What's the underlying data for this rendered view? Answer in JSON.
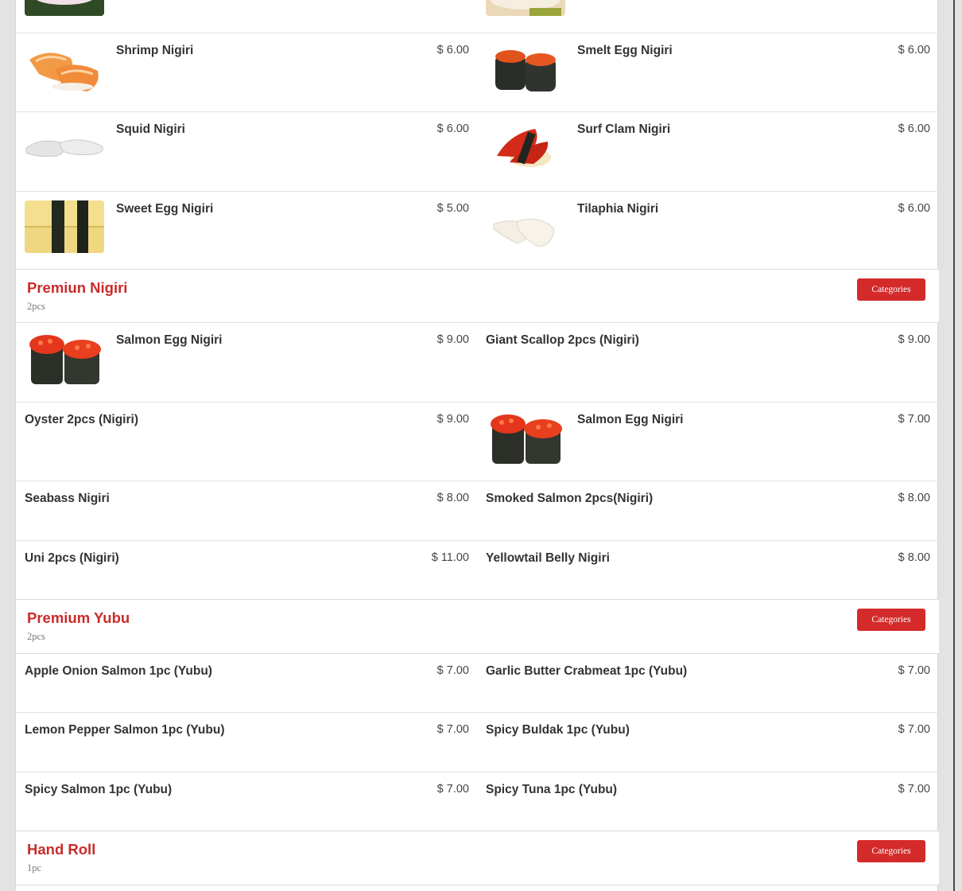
{
  "rows_nigiri": [
    {
      "left": {
        "name": "",
        "price": ""
      },
      "right": {
        "name": "",
        "price": ""
      }
    },
    {
      "left": {
        "name": "Shrimp Nigiri",
        "price": "$ 6.00",
        "image": "shrimp-nigiri-photo"
      },
      "right": {
        "name": "Smelt Egg Nigiri",
        "price": "$ 6.00",
        "image": "smelt-egg-nigiri-photo"
      }
    },
    {
      "left": {
        "name": "Squid Nigiri",
        "price": "$ 6.00",
        "image": "squid-nigiri-photo"
      },
      "right": {
        "name": "Surf Clam Nigiri",
        "price": "$ 6.00",
        "image": "surf-clam-nigiri-photo"
      }
    },
    {
      "left": {
        "name": "Sweet Egg Nigiri",
        "price": "$ 5.00",
        "image": "sweet-egg-nigiri-photo"
      },
      "right": {
        "name": "Tilaphia Nigiri",
        "price": "$ 6.00",
        "image": "tilapia-nigiri-photo"
      }
    }
  ],
  "sections": [
    {
      "title": "Premiun Nigiri",
      "subtitle": "2pcs",
      "button": "Categories",
      "rows": [
        {
          "left": {
            "name": "Salmon Egg Nigiri",
            "price": "$ 9.00",
            "image": "salmon-egg-nigiri-photo"
          },
          "right": {
            "name": "Giant Scallop 2pcs (Nigiri)",
            "price": "$ 9.00"
          }
        },
        {
          "left": {
            "name": "Oyster 2pcs (Nigiri)",
            "price": "$ 9.00"
          },
          "right": {
            "name": "Salmon Egg Nigiri",
            "price": "$ 7.00",
            "image": "salmon-egg-nigiri-photo"
          }
        },
        {
          "left": {
            "name": "Seabass Nigiri",
            "price": "$ 8.00"
          },
          "right": {
            "name": "Smoked Salmon 2pcs(Nigiri)",
            "price": "$ 8.00"
          }
        },
        {
          "left": {
            "name": "Uni 2pcs (Nigiri)",
            "price": "$ 11.00"
          },
          "right": {
            "name": "Yellowtail Belly Nigiri",
            "price": "$ 8.00"
          }
        }
      ]
    },
    {
      "title": "Premium Yubu",
      "subtitle": "2pcs",
      "button": "Categories",
      "rows": [
        {
          "left": {
            "name": "Apple Onion Salmon 1pc (Yubu)",
            "price": "$ 7.00"
          },
          "right": {
            "name": "Garlic Butter Crabmeat 1pc (Yubu)",
            "price": "$ 7.00"
          }
        },
        {
          "left": {
            "name": "Lemon Pepper Salmon 1pc (Yubu)",
            "price": "$ 7.00"
          },
          "right": {
            "name": "Spicy Buldak 1pc (Yubu)",
            "price": "$ 7.00"
          }
        },
        {
          "left": {
            "name": "Spicy Salmon 1pc (Yubu)",
            "price": "$ 7.00"
          },
          "right": {
            "name": "Spicy Tuna 1pc (Yubu)",
            "price": "$ 7.00"
          }
        }
      ]
    },
    {
      "title": "Hand Roll",
      "subtitle": "1pc",
      "button": "Categories",
      "rows": []
    }
  ],
  "colors": {
    "accent": "#c92a2a",
    "button": "#d42a2a"
  }
}
